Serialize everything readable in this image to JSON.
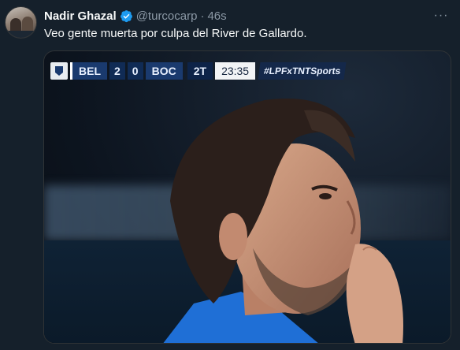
{
  "tweet": {
    "display_name": "Nadir Ghazal",
    "handle": "@turcocarp",
    "separator": "·",
    "time": "46s",
    "more_label": "···",
    "text": "Veo gente muerta por culpa del River de Gallardo."
  },
  "scoreboard": {
    "team_home": "BEL",
    "score_home": "2",
    "score_away": "0",
    "team_away": "BOC",
    "period": "2T",
    "clock": "23:35",
    "hashtag": "#LPFxTNTSports"
  },
  "colors": {
    "background": "#15202b",
    "verified": "#1d9bf0",
    "secondary_text": "#8b98a5",
    "primary_text": "#f7f9f9"
  },
  "icons": {
    "verified": "verified-badge-icon",
    "more": "more-options-icon",
    "league_logo": "league-logo-icon"
  }
}
